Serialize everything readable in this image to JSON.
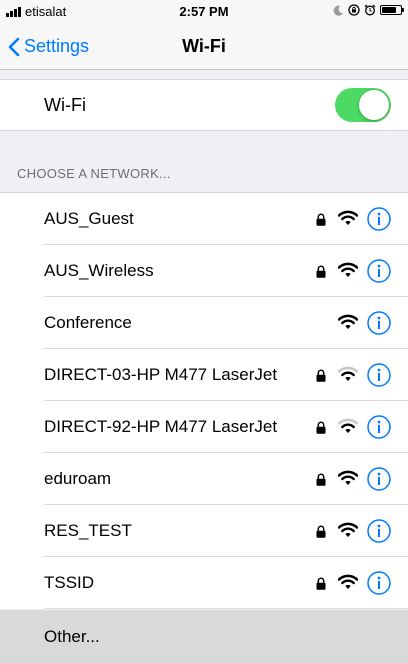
{
  "status_bar": {
    "carrier": "etisalat",
    "time": "2:57 PM"
  },
  "nav": {
    "back_label": "Settings",
    "title": "Wi-Fi"
  },
  "wifi_toggle": {
    "label": "Wi-Fi",
    "on": true
  },
  "section_header": "CHOOSE A NETWORK...",
  "networks": [
    {
      "name": "AUS_Guest",
      "secured": true,
      "signal": "full"
    },
    {
      "name": "AUS_Wireless",
      "secured": true,
      "signal": "full"
    },
    {
      "name": "Conference",
      "secured": false,
      "signal": "full"
    },
    {
      "name": "DIRECT-03-HP M477 LaserJet",
      "secured": true,
      "signal": "weak"
    },
    {
      "name": "DIRECT-92-HP M477 LaserJet",
      "secured": true,
      "signal": "weak"
    },
    {
      "name": "eduroam",
      "secured": true,
      "signal": "full"
    },
    {
      "name": "RES_TEST",
      "secured": true,
      "signal": "full"
    },
    {
      "name": "TSSID",
      "secured": true,
      "signal": "full"
    }
  ],
  "other_label": "Other...",
  "colors": {
    "accent": "#007aff",
    "toggle_on": "#4cd964"
  }
}
